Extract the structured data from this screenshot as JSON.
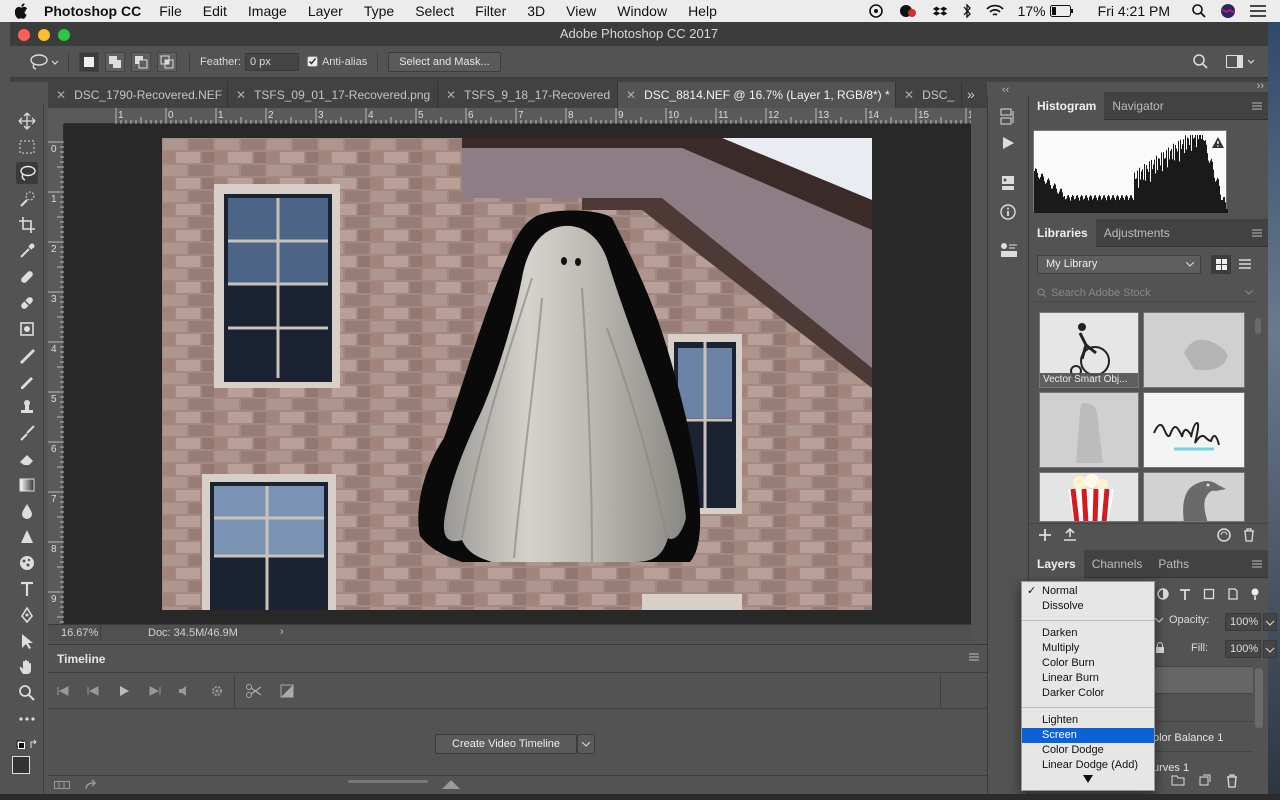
{
  "menubar": {
    "app_name": "Photoshop CC",
    "items": [
      "File",
      "Edit",
      "Image",
      "Layer",
      "Type",
      "Select",
      "Filter",
      "3D",
      "View",
      "Window",
      "Help"
    ],
    "battery": "17%",
    "clock": "Fri 4:21 PM"
  },
  "window": {
    "title": "Adobe Photoshop CC 2017"
  },
  "options": {
    "feather_label": "Feather:",
    "feather_value": "0 px",
    "antialias_label": "Anti-alias",
    "mask_button": "Select and Mask..."
  },
  "tabs": [
    {
      "label": "DSC_1790-Recovered.NEF"
    },
    {
      "label": "TSFS_09_01_17-Recovered.png"
    },
    {
      "label": "TSFS_9_18_17-Recovered"
    },
    {
      "label": "DSC_8814.NEF @ 16.7% (Layer 1, RGB/8*) *"
    },
    {
      "label": "DSC_"
    }
  ],
  "ruler": {
    "h_ticks": [
      "1",
      "0",
      "1",
      "2",
      "3",
      "4",
      "5",
      "6",
      "7",
      "8",
      "9",
      "10",
      "11",
      "12",
      "13",
      "14",
      "15",
      "1"
    ],
    "v_ticks": [
      "0",
      "1",
      "2",
      "3",
      "4",
      "5",
      "6",
      "7",
      "8",
      "9"
    ]
  },
  "status": {
    "zoom": "16.67%",
    "doc": "Doc: 34.5M/46.9M"
  },
  "timeline": {
    "title": "Timeline",
    "create_button": "Create Video Timeline"
  },
  "panels": {
    "histogram_tabs": [
      "Histogram",
      "Navigator"
    ],
    "libraries_tabs": [
      "Libraries",
      "Adjustments"
    ],
    "library_name": "My Library",
    "search_placeholder": "Search Adobe Stock",
    "library_item_label": "Vector Smart Obj...",
    "layers_tabs": [
      "Layers",
      "Channels",
      "Paths"
    ],
    "opacity_label": "Opacity:",
    "opacity_value": "100%",
    "fill_label": "Fill:",
    "fill_value": "100%",
    "layer_partial_1": "olor Balance 1",
    "layer_partial_2": "urves 1"
  },
  "blend_modes": {
    "checkmark": "✓",
    "group1": [
      "Normal",
      "Dissolve"
    ],
    "group2": [
      "Darken",
      "Multiply",
      "Color Burn",
      "Linear Burn",
      "Darker Color"
    ],
    "group3": [
      "Lighten",
      "Screen",
      "Color Dodge",
      "Linear Dodge (Add)"
    ],
    "selected": "Screen"
  },
  "colors": {
    "selection_blue": "#0a62d6",
    "panel_bg": "#535353",
    "canvas_bg": "#282828"
  }
}
